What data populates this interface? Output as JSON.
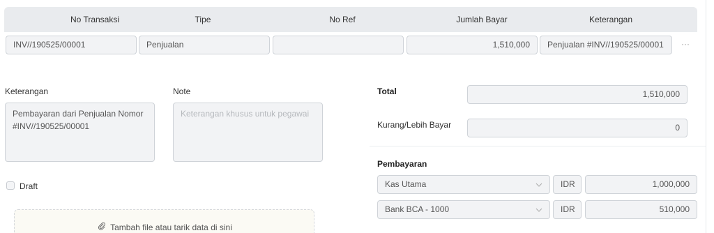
{
  "table": {
    "headers": [
      "No Transaksi",
      "Tipe",
      "No Ref",
      "Jumlah Bayar",
      "Keterangan"
    ],
    "row": {
      "no_transaksi": "INV//190525/00001",
      "tipe": "Penjualan",
      "no_ref": "",
      "jumlah_bayar": "1,510,000",
      "keterangan": "Penjualan #INV//190525/00001",
      "more": "···"
    }
  },
  "form": {
    "keterangan_label": "Keterangan",
    "keterangan_value": "Pembayaran dari Penjualan Nomor\n#INV//190525/00001",
    "note_label": "Note",
    "note_placeholder": "Keterangan khusus untuk pegawai",
    "draft_label": "Draft",
    "upload_text": "Tambah file atau tarik data di sini"
  },
  "summary": {
    "total_label": "Total",
    "total_value": "1,510,000",
    "kurang_label": "Kurang/Lebih Bayar",
    "kurang_value": "0",
    "pembayaran_label": "Pembayaran",
    "payments": [
      {
        "account": "Kas Utama",
        "currency": "IDR",
        "amount": "1,000,000"
      },
      {
        "account": "Bank BCA - 1000",
        "currency": "IDR",
        "amount": "510,000"
      }
    ]
  },
  "icons": {
    "dropdown": "chevron-down-icon",
    "attach": "paperclip-icon"
  }
}
